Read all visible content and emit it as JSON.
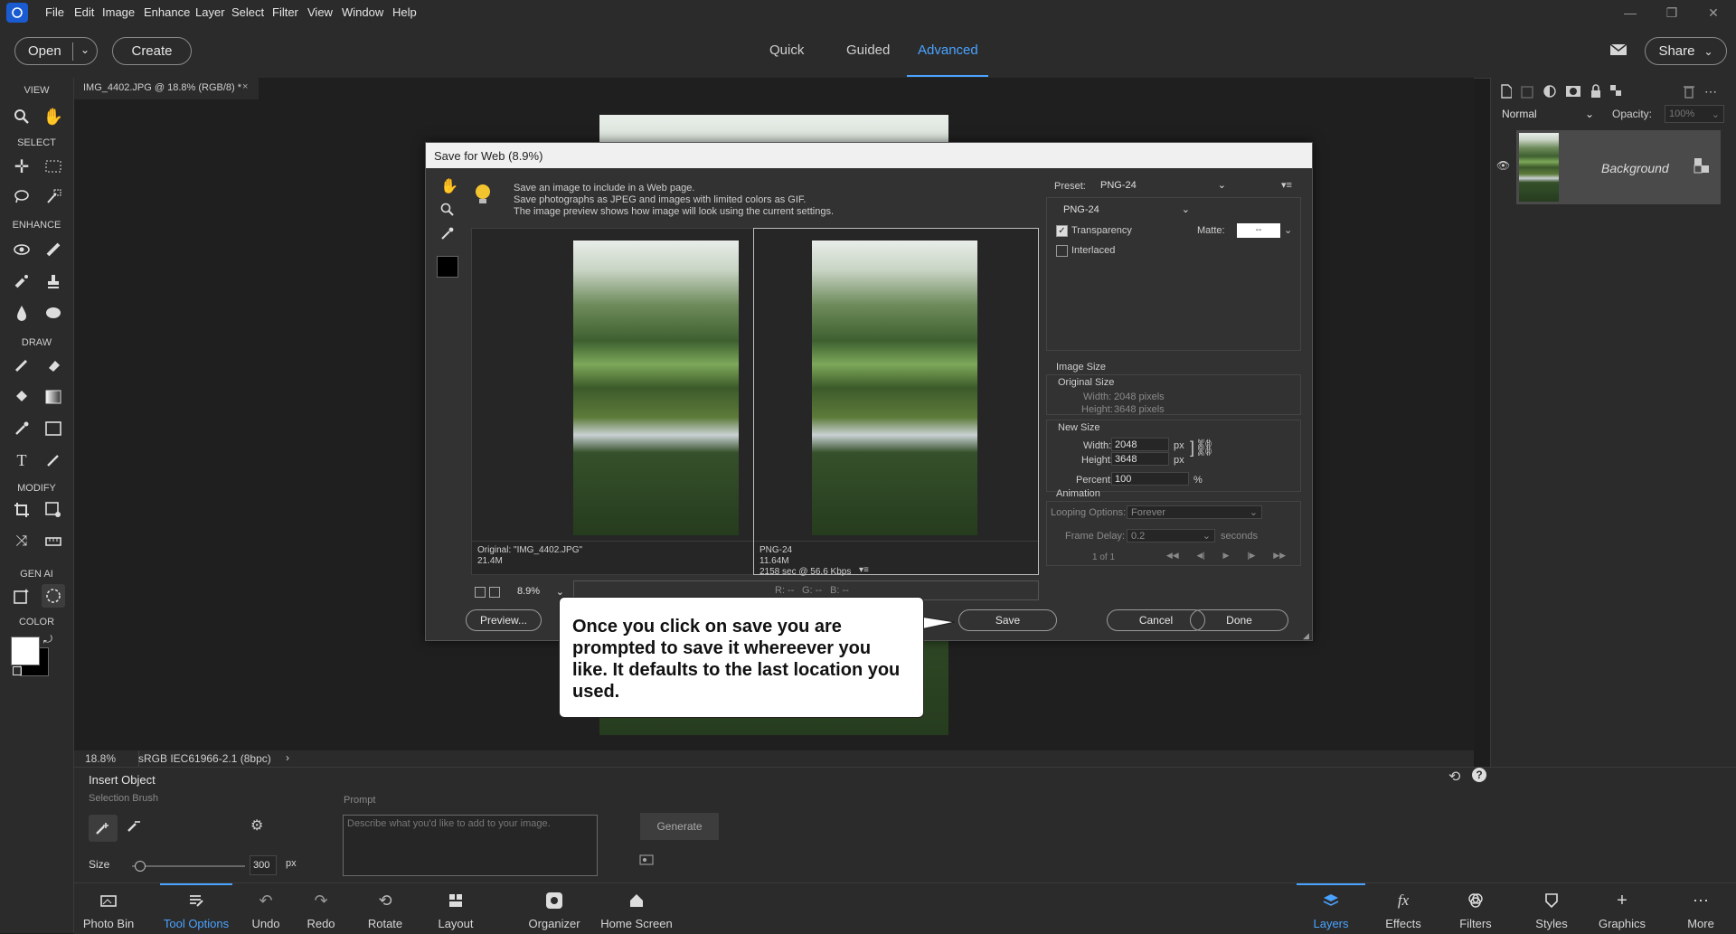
{
  "menu": [
    "File",
    "Edit",
    "Image",
    "Enhance",
    "Layer",
    "Select",
    "Filter",
    "View",
    "Window",
    "Help"
  ],
  "topbar": {
    "open": "Open",
    "create": "Create",
    "modes": [
      "Quick",
      "Guided",
      "Advanced"
    ],
    "active_mode": "Advanced",
    "share": "Share"
  },
  "toolbar": {
    "sections": [
      "VIEW",
      "SELECT",
      "ENHANCE",
      "DRAW",
      "MODIFY",
      "GEN AI",
      "COLOR"
    ]
  },
  "doc_tab": {
    "title": "IMG_4402.JPG @ 18.8% (RGB/8) *",
    "close": "×"
  },
  "status": {
    "zoom": "18.8%",
    "profile": "sRGB IEC61966-2.1 (8bpc)",
    "arrow": "›"
  },
  "dialog": {
    "title": "Save for Web (8.9%)",
    "info": [
      "Save an image to include in a Web page.",
      "Save photographs as JPEG and images with limited colors as GIF.",
      "The image preview shows how image will look using the current settings."
    ],
    "orig_caption": [
      "Original: \"IMG_4402.JPG\"",
      "21.4M"
    ],
    "opt_caption": [
      "PNG-24",
      "11.64M",
      "2158 sec @ 56.6 Kbps"
    ],
    "zoom": "8.9%",
    "readout": {
      "r": "R: --",
      "g": "G: --",
      "b": "B: --"
    },
    "preset_label": "Preset:",
    "preset_value": "PNG-24",
    "format_value": "PNG-24",
    "transparency": "Transparency",
    "interlaced": "Interlaced",
    "matte_label": "Matte:",
    "matte_value": "--",
    "image_size": "Image Size",
    "original_size": "Original Size",
    "orig_width_label": "Width:",
    "orig_width": "2048 pixels",
    "orig_height_label": "Height:",
    "orig_height": "3648 pixels",
    "new_size": "New Size",
    "new_width_label": "Width:",
    "new_width": "2048",
    "new_height_label": "Height:",
    "new_height": "3648",
    "px": "px",
    "percent_label": "Percent:",
    "percent": "100",
    "pct": "%",
    "animation": "Animation",
    "looping_label": "Looping Options:",
    "looping": "Forever",
    "delay_label": "Frame Delay:",
    "delay": "0.2",
    "seconds": "seconds",
    "frame_count": "1 of 1",
    "preview_btn": "Preview...",
    "save_btn": "Save",
    "cancel_btn": "Cancel",
    "done_btn": "Done"
  },
  "callout": {
    "text": "Once you click on save you are prompted to save it whereever you like.   It defaults to the last location you used."
  },
  "right_panel": {
    "blend": "Normal",
    "opacity_label": "Opacity:",
    "opacity": "100%",
    "layer_name": "Background"
  },
  "options": {
    "title": "Insert Object",
    "brush_label": "Selection Brush",
    "prompt_label": "Prompt",
    "prompt_placeholder": "Describe what you'd like to add to your image.",
    "generate": "Generate",
    "size_label": "Size",
    "size_value": "300",
    "px": "px"
  },
  "dock_left": [
    "Photo Bin",
    "Tool Options",
    "Undo",
    "Redo",
    "Rotate",
    "Layout",
    "Organizer",
    "Home Screen"
  ],
  "dock_right": [
    "Layers",
    "Effects",
    "Filters",
    "Styles",
    "Graphics",
    "More"
  ],
  "colors": {
    "accent": "#4aa3ff",
    "bg": "#1d1d1d",
    "panel": "#2b2b2b"
  }
}
